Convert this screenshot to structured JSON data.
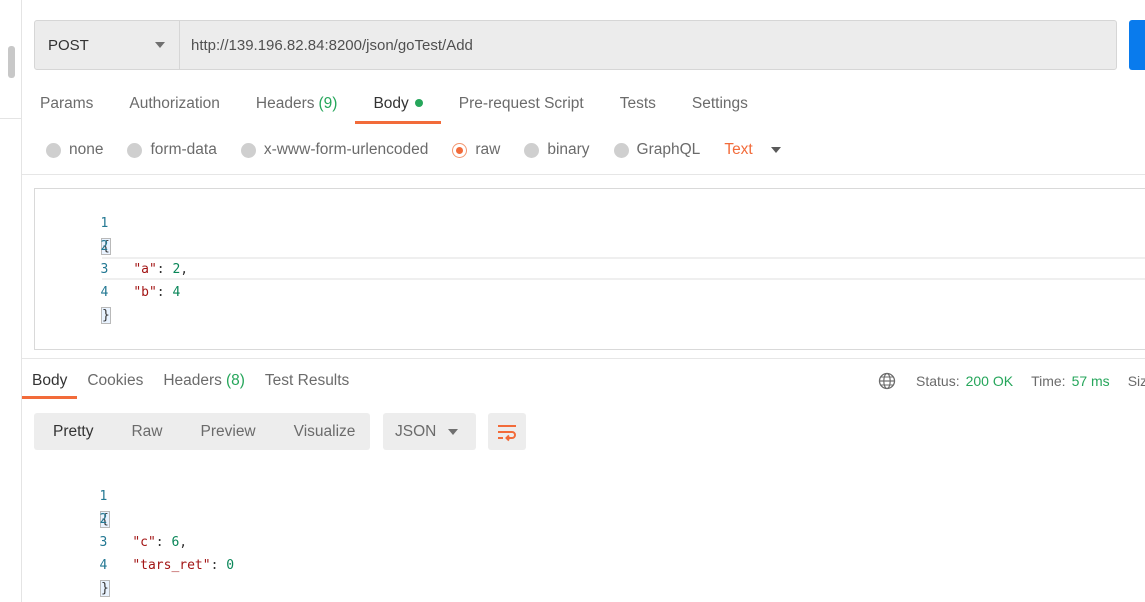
{
  "request": {
    "method": "POST",
    "url": "http://139.196.82.84:8200/json/goTest/Add"
  },
  "req_tabs": [
    {
      "label": "Params"
    },
    {
      "label": "Authorization"
    },
    {
      "label": "Headers",
      "count": "(9)"
    },
    {
      "label": "Body"
    },
    {
      "label": "Pre-request Script"
    },
    {
      "label": "Tests"
    },
    {
      "label": "Settings"
    }
  ],
  "body_types": [
    {
      "label": "none"
    },
    {
      "label": "form-data"
    },
    {
      "label": "x-www-form-urlencoded"
    },
    {
      "label": "raw"
    },
    {
      "label": "binary"
    },
    {
      "label": "GraphQL"
    }
  ],
  "raw_type": "Text",
  "request_body": {
    "line_numbers": [
      "1",
      "2",
      "3",
      "4"
    ],
    "open": "{",
    "key_a": "\"a\"",
    "val_a": "2",
    "key_b": "\"b\"",
    "val_b": "4",
    "close": "}"
  },
  "resp_tabs": [
    {
      "label": "Body"
    },
    {
      "label": "Cookies"
    },
    {
      "label": "Headers",
      "count": "(8)"
    },
    {
      "label": "Test Results"
    }
  ],
  "status": {
    "status_label": "Status:",
    "status_value": "200 OK",
    "time_label": "Time:",
    "time_value": "57 ms",
    "size_label": "Size"
  },
  "view_modes": [
    "Pretty",
    "Raw",
    "Preview",
    "Visualize"
  ],
  "format": "JSON",
  "response_body": {
    "line_numbers": [
      "1",
      "2",
      "3",
      "4"
    ],
    "open": "{",
    "key_c": "\"c\"",
    "val_c": "6",
    "key_ret": "\"tars_ret\"",
    "val_ret": "0",
    "close": "}"
  },
  "colors": {
    "accent": "#f26b3a",
    "success": "#26a65b",
    "send_button": "#097bed"
  }
}
